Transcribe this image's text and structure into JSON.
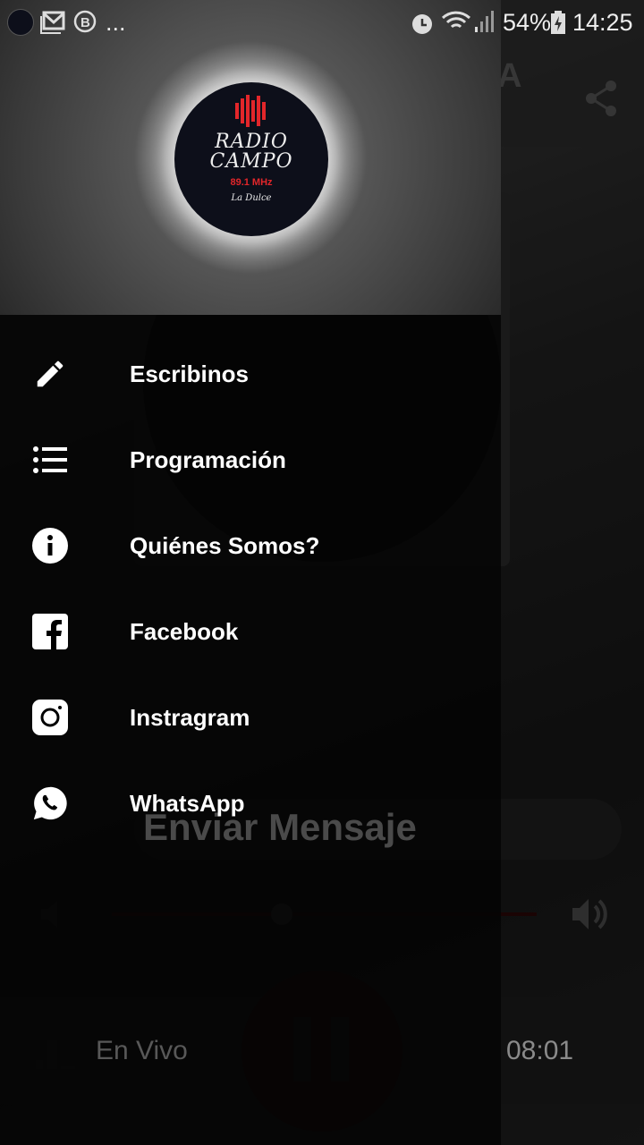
{
  "status_bar": {
    "battery": "54%",
    "time": "14:25",
    "notification_more": "...",
    "icons": [
      "radio-app-icon",
      "gmail-icon",
      "bip-icon",
      "alarm-icon",
      "wifi-icon",
      "signal-icon",
      "battery-charging-icon"
    ]
  },
  "app": {
    "title_fragment": "A",
    "send_message": "Enviar Mensaje",
    "volume": 0.4,
    "live_label": "En Vivo",
    "elapsed": "08:01",
    "accent": "#e3262a"
  },
  "drawer": {
    "logo": {
      "name_line1": "RADIO",
      "name_line2": "CAMPO",
      "frequency": "89.1 MHz",
      "tagline": "La Dulce"
    },
    "items": [
      {
        "label": "Escribinos",
        "icon": "pencil-icon"
      },
      {
        "label": "Programación",
        "icon": "list-icon"
      },
      {
        "label": "Quiénes Somos?",
        "icon": "info-icon"
      },
      {
        "label": "Facebook",
        "icon": "facebook-icon"
      },
      {
        "label": "Instragram",
        "icon": "instagram-icon"
      },
      {
        "label": "WhatsApp",
        "icon": "whatsapp-icon"
      }
    ]
  }
}
